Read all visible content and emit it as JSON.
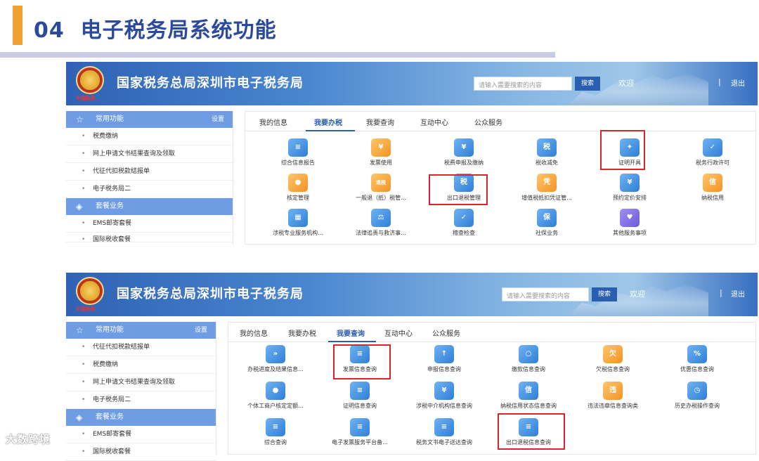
{
  "slide": {
    "number": "04",
    "title": "电子税务局系统功能"
  },
  "screen1": {
    "site_title": "国家税务总局深圳市电子税务局",
    "emblem_text": "中国税务",
    "search_placeholder": "请输入需要搜索的内容",
    "search_button": "搜索",
    "welcome": "欢迎",
    "separator": "|",
    "logout": "退出",
    "sidebar": {
      "common_title": "常用功能",
      "settings": "设置",
      "common_items": [
        "税费缴纳",
        "网上申请文书结果查询及领取",
        "代征代扣税款结报单",
        "电子税务局二"
      ],
      "package_title": "套餐业务",
      "package_items": [
        "EMS邮寄套餐",
        "国际税收套餐"
      ]
    },
    "tabs": [
      "我的信息",
      "我要办税",
      "我要查询",
      "互动中心",
      "公众服务"
    ],
    "active_tab": "我要办税",
    "tiles": [
      {
        "label": "综合信息报告",
        "icon": "report-icon",
        "glyph": "≡"
      },
      {
        "label": "发票使用",
        "icon": "invoice-icon",
        "glyph": "¥"
      },
      {
        "label": "税费申报及缴纳",
        "icon": "tax-payment-icon",
        "glyph": "¥"
      },
      {
        "label": "税收减免",
        "icon": "tax-relief-icon",
        "glyph": "税"
      },
      {
        "label": "证明开具",
        "icon": "certificate-icon",
        "glyph": "✦"
      },
      {
        "label": "税务行政许可",
        "icon": "permit-icon",
        "glyph": "✓"
      },
      {
        "label": "核定管理",
        "icon": "user-icon",
        "glyph": "●"
      },
      {
        "label": "一般退（抵）税管...",
        "icon": "refund-icon",
        "glyph": "退税"
      },
      {
        "label": "出口退税管理",
        "icon": "export-refund-icon",
        "glyph": "税"
      },
      {
        "label": "增值税抵扣凭证管...",
        "icon": "voucher-icon",
        "glyph": "凭"
      },
      {
        "label": "预约定价安排",
        "icon": "calendar-icon",
        "glyph": "¥"
      },
      {
        "label": "纳税信用",
        "icon": "credit-icon",
        "glyph": "信"
      },
      {
        "label": "涉税专业服务机构...",
        "icon": "building-icon",
        "glyph": "▦"
      },
      {
        "label": "法律追责与救济事...",
        "icon": "gavel-icon",
        "glyph": "⚖"
      },
      {
        "label": "稽查检查",
        "icon": "inspection-icon",
        "glyph": "✓"
      },
      {
        "label": "社保业务",
        "icon": "social-security-icon",
        "glyph": "保"
      },
      {
        "label": "其他服务事项",
        "icon": "heart-icon",
        "glyph": "♥"
      }
    ]
  },
  "screen2": {
    "site_title": "国家税务总局深圳市电子税务局",
    "emblem_text": "中国税务",
    "search_placeholder": "请输入需要搜索的内容",
    "search_button": "搜索",
    "welcome": "欢迎",
    "separator": "|",
    "logout": "退出",
    "sidebar": {
      "common_title": "常用功能",
      "settings": "设置",
      "common_items": [
        "代征代扣税款结报单",
        "税费缴纳",
        "网上申请文书结果查询及领取",
        "电子税务局二"
      ],
      "package_title": "套餐业务",
      "package_items": [
        "EMS邮寄套餐",
        "国际税收套餐"
      ]
    },
    "tabs": [
      "我的信息",
      "我要办税",
      "我要查询",
      "互动中心",
      "公众服务"
    ],
    "active_tab": "我要查询",
    "tiles": [
      {
        "label": "办税进度及结果信息...",
        "icon": "progress-icon",
        "glyph": "»"
      },
      {
        "label": "发票信息查询",
        "icon": "invoice-search-icon",
        "glyph": "≡"
      },
      {
        "label": "申报信息查询",
        "icon": "declaration-icon",
        "glyph": "↑"
      },
      {
        "label": "缴款信息查询",
        "icon": "search-icon",
        "glyph": "○"
      },
      {
        "label": "欠税信息查询",
        "icon": "arrears-icon",
        "glyph": "欠"
      },
      {
        "label": "优惠信息查询",
        "icon": "discount-icon",
        "glyph": "%"
      },
      {
        "label": "个体工商户核定定额...",
        "icon": "merchant-icon",
        "glyph": "●"
      },
      {
        "label": "证明信息查询",
        "icon": "certificate-search-icon",
        "glyph": "≡"
      },
      {
        "label": "涉税中介机构信息查询",
        "icon": "agency-icon",
        "glyph": "¥"
      },
      {
        "label": "纳税信用状态信息查询",
        "icon": "credit-search-icon",
        "glyph": "信"
      },
      {
        "label": "违法违章信息查询类",
        "icon": "violation-icon",
        "glyph": "违"
      },
      {
        "label": "历史办税操作查询",
        "icon": "history-icon",
        "glyph": "◷"
      },
      {
        "label": "综合查询",
        "icon": "general-search-icon",
        "glyph": "≡"
      },
      {
        "label": "电子发票服务平台备...",
        "icon": "e-invoice-icon",
        "glyph": "≡"
      },
      {
        "label": "税务文书电子送达查询",
        "icon": "document-icon",
        "glyph": "≡"
      },
      {
        "label": "出口退税信息查询",
        "icon": "export-refund-search-icon",
        "glyph": "≡"
      }
    ]
  },
  "watermark": "大数跨境"
}
